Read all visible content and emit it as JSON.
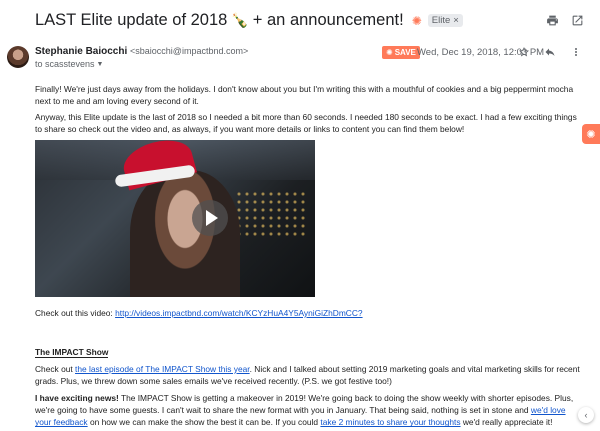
{
  "email": {
    "subject": "LAST Elite update of 2018",
    "subject_emoji": "🍾",
    "subject_suffix": "+ an announcement!",
    "label": "Elite",
    "label_close": "×",
    "sender_name": "Stephanie Baiocchi",
    "sender_email": "<sbaiocchi@impactbnd.com>",
    "to_line": "to scasstevens",
    "save_label": "SAVE",
    "date": "Wed, Dec 19, 2018, 12:03 PM"
  },
  "body": {
    "p1": "Finally! We're just days away from the holidays. I don't know about you but I'm writing this with a mouthful of cookies and a big peppermint mocha next to me and am loving every second of it.",
    "p2": "Anyway, this Elite update is the last of 2018 so I needed a bit more than 60 seconds. I needed 180 seconds to be exact. I had a few exciting things to share so check out the video and, as always, if you want more details or links to content you can find them below!",
    "video_prefix": "Check out this video: ",
    "video_link": "http://videos.impactbnd.com/watch/KCYzHuA4Y5AyniGiZhDmCC?",
    "heading": "The IMPACT Show",
    "p5_pre": "Check out ",
    "p5_link": "the last episode of The IMPACT Show this year",
    "p5_post": ". Nick and I talked about setting 2019 marketing goals and vital marketing skills for recent grads. Plus, we threw down some sales emails we've received recently. (P.S. we got festive too!)",
    "p6_bold": "I have exciting news!",
    "p6_mid": " The IMPACT Show is getting a makeover in 2019! We're going back to doing the show weekly with shorter episodes. Plus, we're going to have some guests. I can't wait to share the new format with you in January. That being said, nothing is set in stone and ",
    "p6_link1": "we'd love your feedback",
    "p6_mid2": " on how we can make the show the best it can be. If you could ",
    "p6_link2": "take 2 minutes to share your thoughts",
    "p6_end": " we'd really appreciate it!"
  },
  "icons": {
    "print": "print-icon",
    "open_new": "open-in-new-icon",
    "star": "star-icon",
    "reply": "reply-icon",
    "more": "more-vert-icon",
    "hubspot": "hubspot-icon"
  },
  "colors": {
    "accent": "#ff7a59",
    "link": "#1155cc"
  }
}
